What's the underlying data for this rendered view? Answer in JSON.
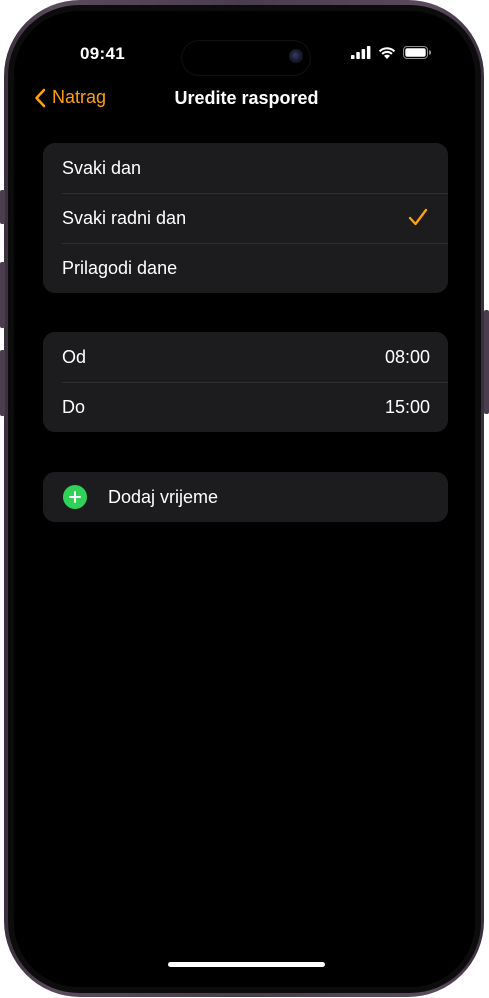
{
  "status_bar": {
    "time": "09:41",
    "icons": [
      "cellular-signal-icon",
      "wifi-icon",
      "battery-icon"
    ]
  },
  "nav": {
    "back_label": "Natrag",
    "title": "Uredite raspored"
  },
  "repeat_options": {
    "items": [
      {
        "label": "Svaki dan",
        "selected": false
      },
      {
        "label": "Svaki radni dan",
        "selected": true
      },
      {
        "label": "Prilagodi dane",
        "selected": false
      }
    ]
  },
  "time_range": {
    "from_label": "Od",
    "from_value": "08:00",
    "to_label": "Do",
    "to_value": "15:00"
  },
  "add_time": {
    "label": "Dodaj vrijeme",
    "icon": "plus-circle-icon"
  },
  "colors": {
    "accent": "#ff9f0a",
    "add_green": "#30d158",
    "background": "#000000",
    "cell": "#1c1c1e"
  }
}
